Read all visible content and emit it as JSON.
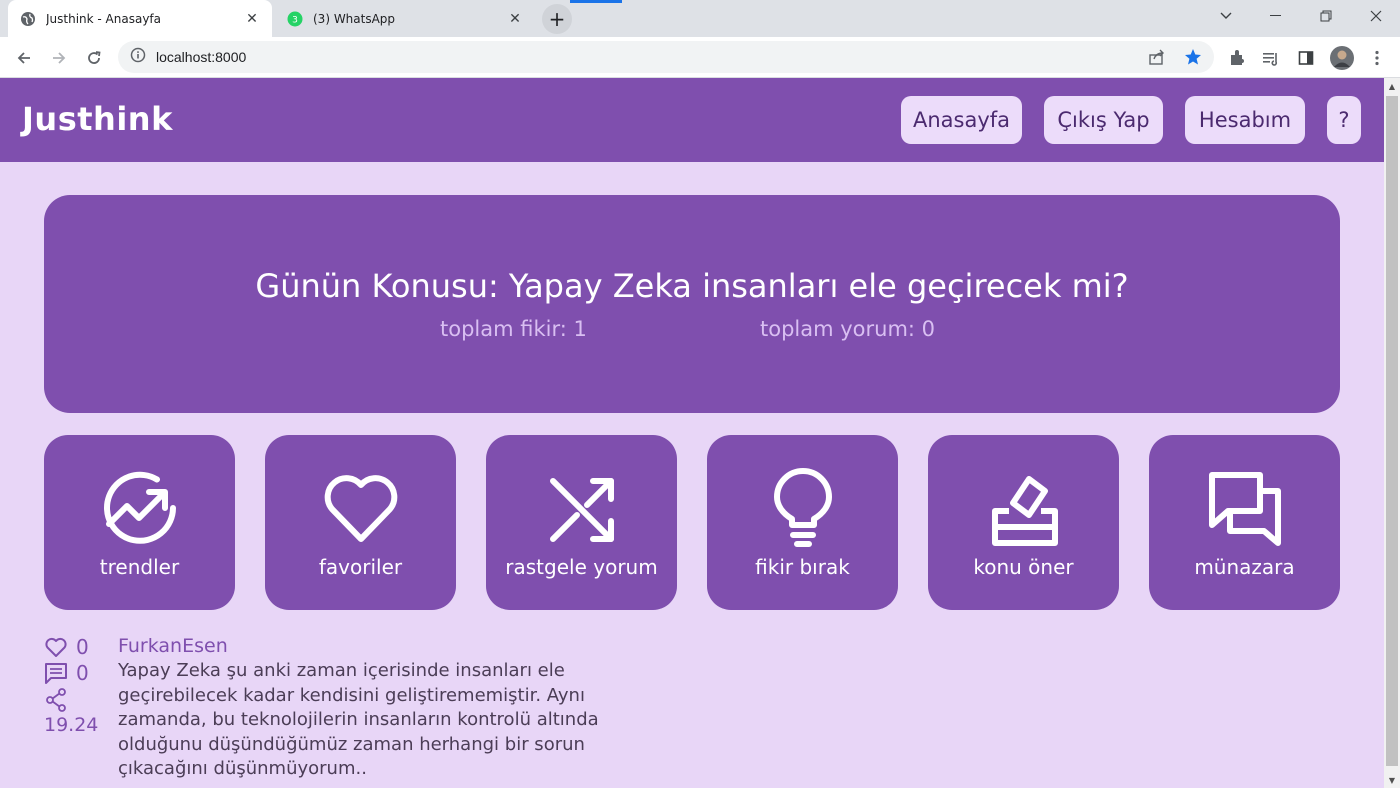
{
  "browser": {
    "tabs": [
      {
        "title": "Justhink - Anasayfa",
        "active": true
      },
      {
        "title": "(3) WhatsApp",
        "active": false,
        "badge": "3"
      }
    ],
    "address": "localhost:8000"
  },
  "site": {
    "brand": "Justhink",
    "nav": {
      "home": "Anasayfa",
      "logout": "Çıkış Yap",
      "account": "Hesabım",
      "help": "?"
    }
  },
  "hero": {
    "title": "Günün Konusu: Yapay Zeka insanları ele geçirecek mi?",
    "ideas": "toplam fikir: 1",
    "comments": "toplam yorum: 0"
  },
  "tiles": [
    {
      "label": "trendler",
      "icon": "trending-icon"
    },
    {
      "label": "favoriler",
      "icon": "heart-icon"
    },
    {
      "label": "rastgele yorum",
      "icon": "shuffle-icon"
    },
    {
      "label": "fikir bırak",
      "icon": "lightbulb-icon"
    },
    {
      "label": "konu öner",
      "icon": "ballot-icon"
    },
    {
      "label": "münazara",
      "icon": "chat-icon"
    }
  ],
  "post": {
    "likes": "0",
    "comments": "0",
    "time": "19.24",
    "author": "FurkanEsen",
    "body": "Yapay Zeka şu anki zaman içerisinde insanları ele geçirebilecek kadar kendisini geliştirememiştir. Aynı zamanda, bu teknolojilerin insanların kontrolü altında olduğunu düşündüğümüz zaman herhangi bir sorun çıkacağını düşünmüyorum.."
  },
  "colors": {
    "primary": "#7f4fae",
    "background": "#e8d6f7",
    "button_bg": "#ecdcfa"
  }
}
